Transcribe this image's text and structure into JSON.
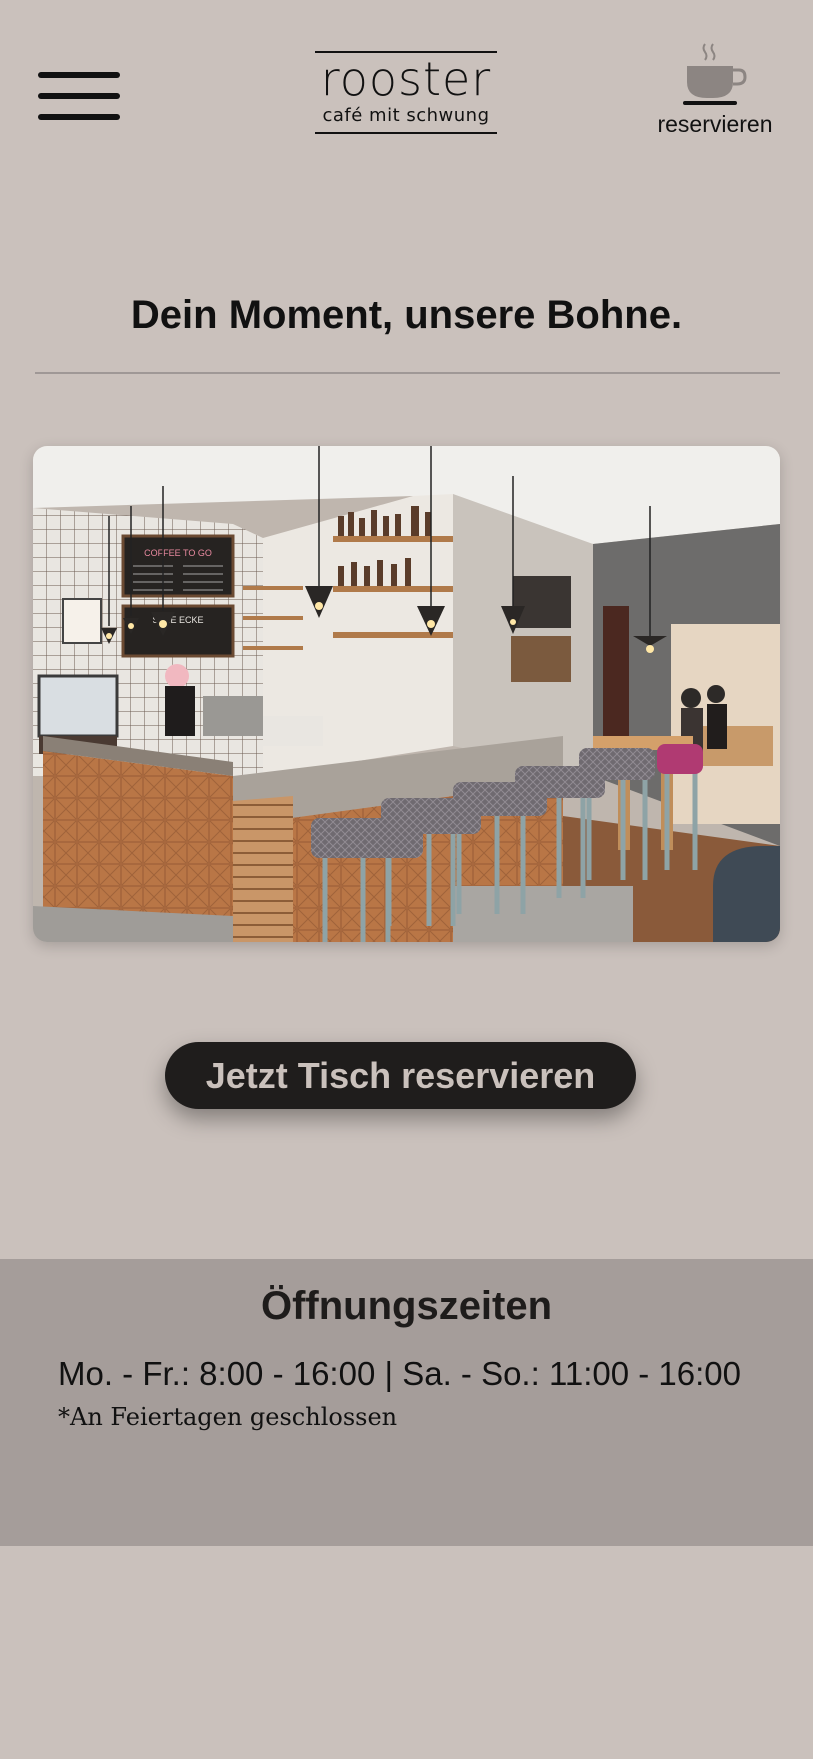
{
  "header": {
    "logo": {
      "name": "rooster",
      "tagline": "café mit schwung"
    },
    "reserve_label": "reservieren",
    "menu_icon": "hamburger-menu-icon",
    "reserve_icon": "coffee-cup-icon"
  },
  "main": {
    "headline": "Dein Moment, unsere Bohne.",
    "hero_image": {
      "subject": "photo",
      "signage": {
        "menu_board": "COFFEE TO GO",
        "lower_board": "SÜßE ECKE"
      }
    },
    "cta_label": "Jetzt Tisch reservieren"
  },
  "hours": {
    "title": "Öffnungszeiten",
    "line": "Mo. - Fr.: 8:00 - 16:00 | Sa. - So.: 11:00 - 16:00",
    "note": "*An Feiertagen geschlossen"
  },
  "colors": {
    "background": "#cac1bc",
    "hours_background": "#a59d9a",
    "cta_background": "#1f1d1c",
    "cta_text": "#cac1bc",
    "text": "#111111"
  }
}
